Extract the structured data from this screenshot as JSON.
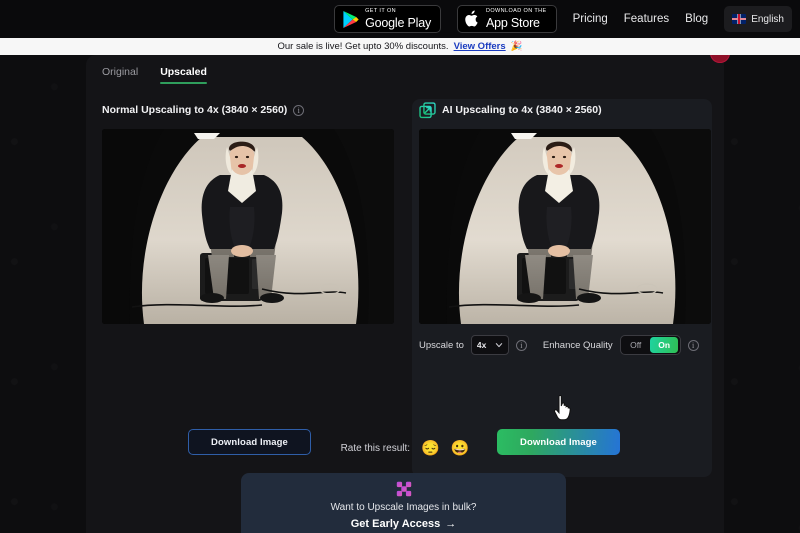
{
  "topnav": {
    "google_play": {
      "small": "GET IT ON",
      "big": "Google Play"
    },
    "app_store": {
      "small": "Download on the",
      "big": "App Store"
    },
    "links": [
      "Pricing",
      "Features",
      "Blog"
    ],
    "language": "English"
  },
  "banner": {
    "text": "Our sale is live! Get upto 30% discounts.",
    "link": "View Offers",
    "emoji": "🎉"
  },
  "tabs": [
    {
      "label": "Original",
      "active": false
    },
    {
      "label": "Upscaled",
      "active": true
    }
  ],
  "panels": {
    "normal": {
      "title": "Normal Upscaling to 4x (3840 × 2560)",
      "download_label": "Download Image"
    },
    "ai": {
      "title": "AI Upscaling to 4x (3840 × 2560)",
      "download_label": "Download Image",
      "upscale_label": "Upscale to",
      "scale_value": "4x",
      "quality_label": "Enhance Quality",
      "quality_off": "Off",
      "quality_on": "On"
    }
  },
  "rate": {
    "label": "Rate this result:",
    "sad_emoji": "😔",
    "happy_emoji": "😀"
  },
  "bulk": {
    "text": "Want to Upscale Images in bulk?",
    "cta": "Get Early Access",
    "arrow": "→"
  },
  "colors": {
    "accent_green": "#2f9e5c",
    "accent_blue": "#2574d6",
    "banner_link": "#1a3bbf",
    "card_bg": "#141417",
    "bulk_bg": "#222c3c"
  }
}
